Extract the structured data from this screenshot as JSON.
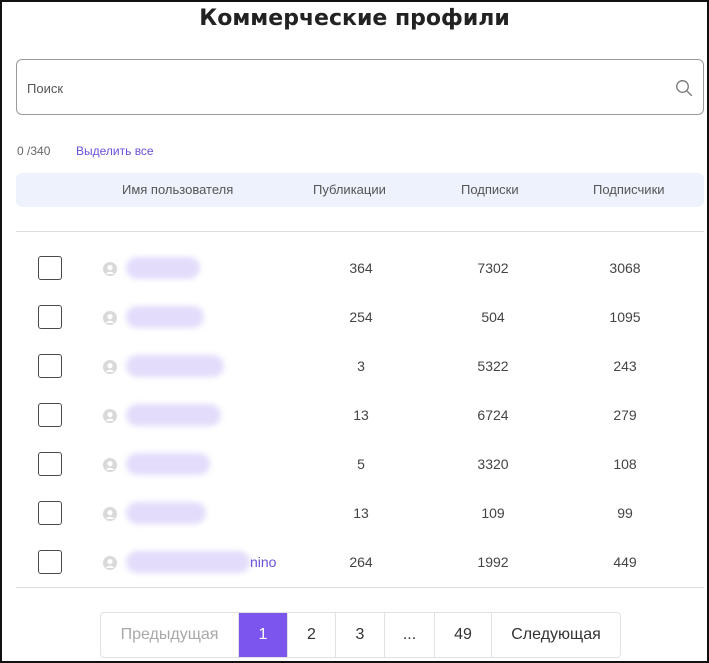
{
  "page": {
    "title": "Коммерческие профили"
  },
  "search": {
    "placeholder": "Поиск",
    "value": ""
  },
  "selection": {
    "counter": "0 /340",
    "select_all_label": "Выделить все"
  },
  "table": {
    "headers": {
      "username": "Имя пользователя",
      "posts": "Публикации",
      "following": "Подписки",
      "followers": "Подписчики"
    },
    "rows": [
      {
        "name_suffix": "",
        "posts": "364",
        "following": "7302",
        "followers": "3068"
      },
      {
        "name_suffix": "",
        "posts": "254",
        "following": "504",
        "followers": "1095"
      },
      {
        "name_suffix": "",
        "posts": "3",
        "following": "5322",
        "followers": "243"
      },
      {
        "name_suffix": "",
        "posts": "13",
        "following": "6724",
        "followers": "279"
      },
      {
        "name_suffix": "",
        "posts": "5",
        "following": "3320",
        "followers": "108"
      },
      {
        "name_suffix": "",
        "posts": "13",
        "following": "109",
        "followers": "99"
      },
      {
        "name_suffix": "nino",
        "posts": "264",
        "following": "1992",
        "followers": "449"
      }
    ]
  },
  "pagination": {
    "prev_label": "Предыдущая",
    "pages": [
      "1",
      "2",
      "3",
      "...",
      "49"
    ],
    "active_page": "1",
    "next_label": "Следующая"
  },
  "colors": {
    "accent": "#7b55ee",
    "link": "#6b4fd8",
    "header_bg": "#edf2fc"
  },
  "icons": {
    "search": "search-icon",
    "avatar": "user-avatar-icon"
  }
}
